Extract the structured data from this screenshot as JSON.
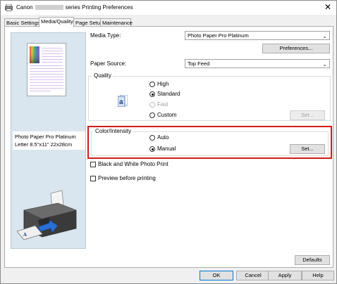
{
  "window": {
    "title_prefix": "Canon",
    "title_suffix": "series Printing Preferences",
    "close_glyph": "✕"
  },
  "tabs": [
    {
      "label": "Basic Settings"
    },
    {
      "label": "Media/Quality"
    },
    {
      "label": "Page Setup"
    },
    {
      "label": "Maintenance"
    }
  ],
  "preview": {
    "media_line1": "Photo Paper Pro Platinum",
    "media_line2": "Letter 8.5\"x11\" 22x28cm"
  },
  "media_type": {
    "label": "Media Type:",
    "value": "Photo Paper Pro Platinum"
  },
  "preferences_button": "Preferences...",
  "paper_source": {
    "label": "Paper Source:",
    "value": "Top Feed"
  },
  "quality": {
    "title": "Quality",
    "options": [
      "High",
      "Standard",
      "Fast",
      "Custom"
    ],
    "selected": "Standard",
    "set_button": "Set...",
    "icon": "document-a-icon"
  },
  "color_intensity": {
    "title": "Color/Intensity",
    "options": [
      "Auto",
      "Manual"
    ],
    "selected": "Manual",
    "set_button": "Set..."
  },
  "black_white_label": "Black and White Photo Print",
  "preview_before_label": "Preview before printing",
  "defaults_button": "Defaults",
  "footer": {
    "ok": "OK",
    "cancel": "Cancel",
    "apply": "Apply",
    "help": "Help"
  },
  "colors": {
    "highlight_border": "#d11a1a",
    "accent": "#0078d7"
  }
}
